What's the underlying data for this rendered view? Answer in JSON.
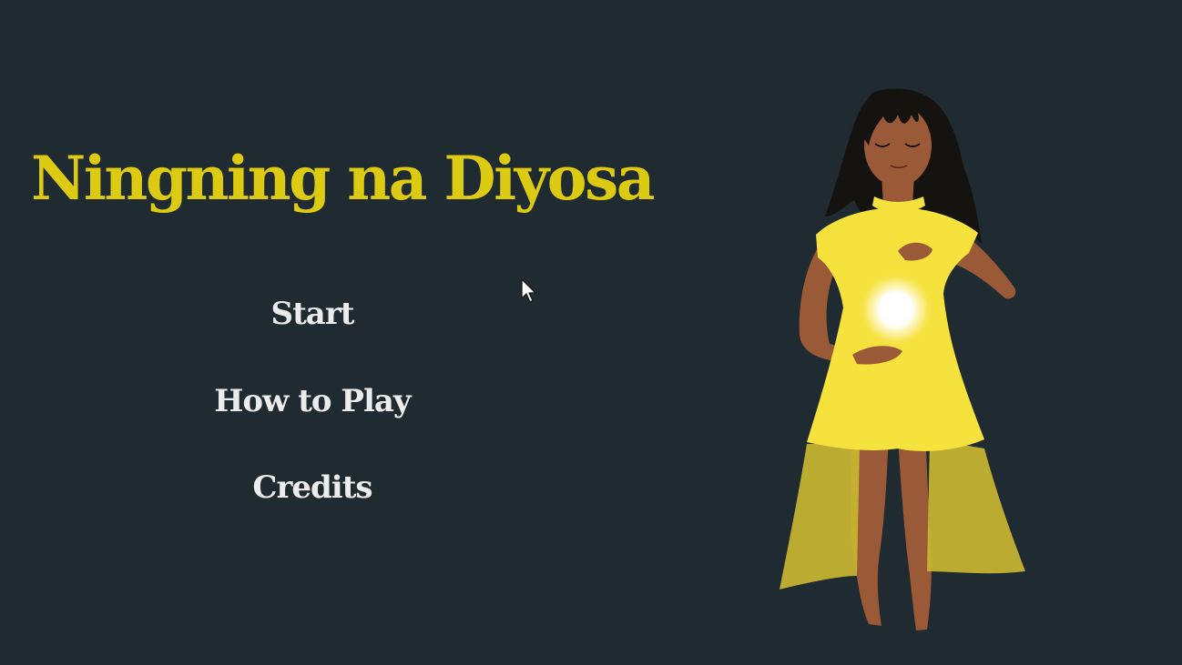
{
  "game": {
    "title": "Ningning na Diyosa"
  },
  "menu": {
    "start_label": "Start",
    "how_to_play_label": "How to Play",
    "credits_label": "Credits"
  },
  "colors": {
    "background": "#202a31",
    "title": "#dccb12",
    "menu_text": "#ececec",
    "dress": "#f5e23c",
    "skirt_shadow": "#c9b631",
    "skin": "#9b5a37",
    "hair": "#15130f",
    "glow": "#ffffff"
  },
  "icons": {
    "cursor": "mouse-pointer-icon",
    "character": "goddess-character-illustration"
  }
}
